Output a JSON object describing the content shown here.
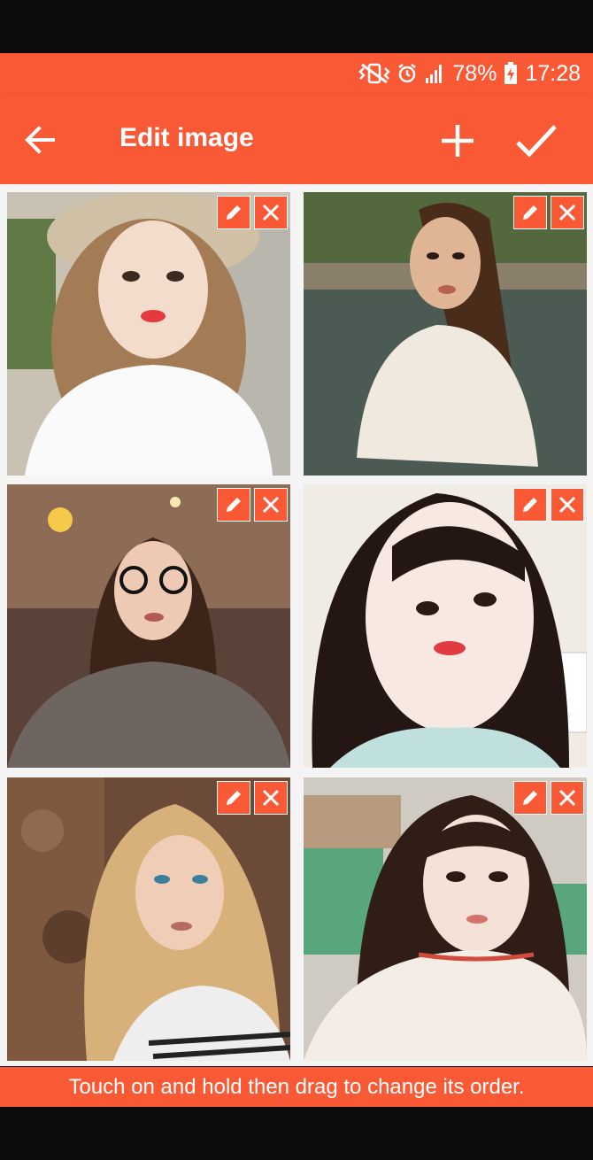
{
  "status_bar": {
    "battery": "78%",
    "time": "17:28",
    "icons": [
      "vibrate-mute-icon",
      "alarm-icon",
      "signal-icon",
      "battery-charging-icon"
    ]
  },
  "app_bar": {
    "title": "Edit image",
    "actions": [
      "back-arrow-icon",
      "plus-icon",
      "check-icon"
    ]
  },
  "images": [
    {
      "index": 1,
      "subject": "girl in hat, white blouse"
    },
    {
      "index": 2,
      "subject": "woman by lake, white sweater"
    },
    {
      "index": 3,
      "subject": "woman with glasses, knit sweater"
    },
    {
      "index": 4,
      "subject": "girl close-up selfie"
    },
    {
      "index": 5,
      "subject": "blonde woman by stone wall"
    },
    {
      "index": 6,
      "subject": "girl in cafe, striped sweater"
    }
  ],
  "tile_actions": [
    "pencil-icon",
    "close-icon"
  ],
  "hint": "Touch on and hold then drag to change its order.",
  "colors": {
    "accent": "#f95a35",
    "background": "#f4f4f4",
    "frame": "#0c0c0c"
  }
}
